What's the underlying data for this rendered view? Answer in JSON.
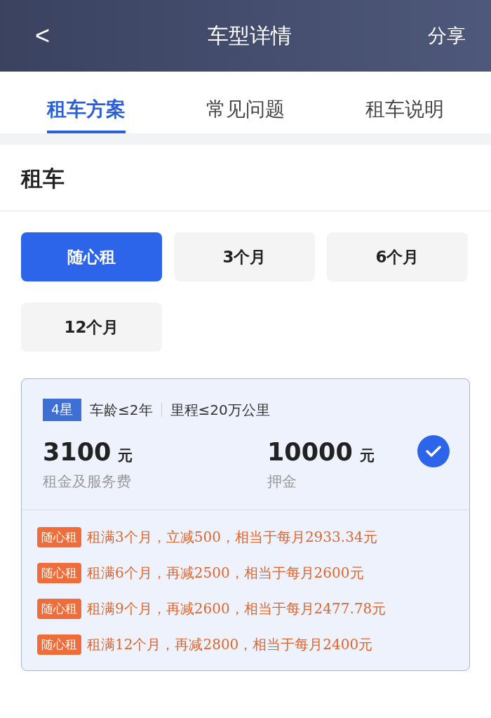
{
  "header": {
    "back": "<",
    "title": "车型详情",
    "action": "分享"
  },
  "tabs": [
    {
      "label": "租车方案",
      "selected": true
    },
    {
      "label": "常见问题",
      "selected": false
    },
    {
      "label": "租车说明",
      "selected": false
    }
  ],
  "section_title": "租车",
  "plans": [
    {
      "label": "随心租",
      "selected": true
    },
    {
      "label": "3个月",
      "selected": false
    },
    {
      "label": "6个月",
      "selected": false
    },
    {
      "label": "12个月",
      "selected": false
    }
  ],
  "offer": {
    "selected": true,
    "grade": "4星",
    "car_age": "车龄≤2年",
    "mileage": "里程≤20万公里",
    "prices": [
      {
        "amount": "3100",
        "unit": "元",
        "label": "租金及服务费"
      },
      {
        "amount": "10000",
        "unit": "元",
        "label": "押金"
      }
    ],
    "promotions": [
      {
        "tag": "随心租",
        "text": "租满3个月，立减500，相当于每月2933.34元"
      },
      {
        "tag": "随心租",
        "text": "租满6个月，再减2500，相当于每月2600元"
      },
      {
        "tag": "随心租",
        "text": "租满9个月，再减2600，相当于每月2477.78元"
      },
      {
        "tag": "随心租",
        "text": "租满12个月，再减2800，相当于每月2400元"
      }
    ]
  }
}
